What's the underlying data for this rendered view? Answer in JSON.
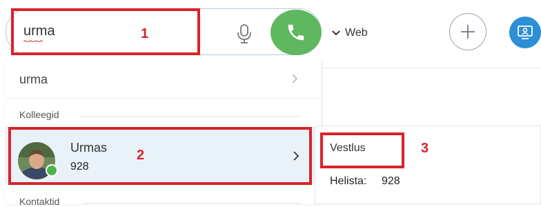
{
  "search": {
    "value": "urma",
    "call_label": ""
  },
  "toolbar": {
    "web_label": "Web"
  },
  "suggestion": {
    "text": "urma"
  },
  "sections": {
    "colleagues": "Kolleegid",
    "contacts": "Kontaktid"
  },
  "contact": {
    "name": "Urmas",
    "extension": "928",
    "presence": "online"
  },
  "submenu": {
    "chat": "Vestlus",
    "call_label": "Helista:",
    "call_value": "928"
  },
  "annotations": [
    "1",
    "2",
    "3"
  ],
  "colors": {
    "accent_green": "#5fb85f",
    "screen_blue": "#2d8fd5",
    "annotation_red": "#d8232a",
    "row_highlight": "#e9f2f8"
  },
  "icons": [
    "microphone-icon",
    "phone-icon",
    "chevron-down-icon",
    "plus-icon",
    "screen-share-icon",
    "chevron-right-icon"
  ]
}
